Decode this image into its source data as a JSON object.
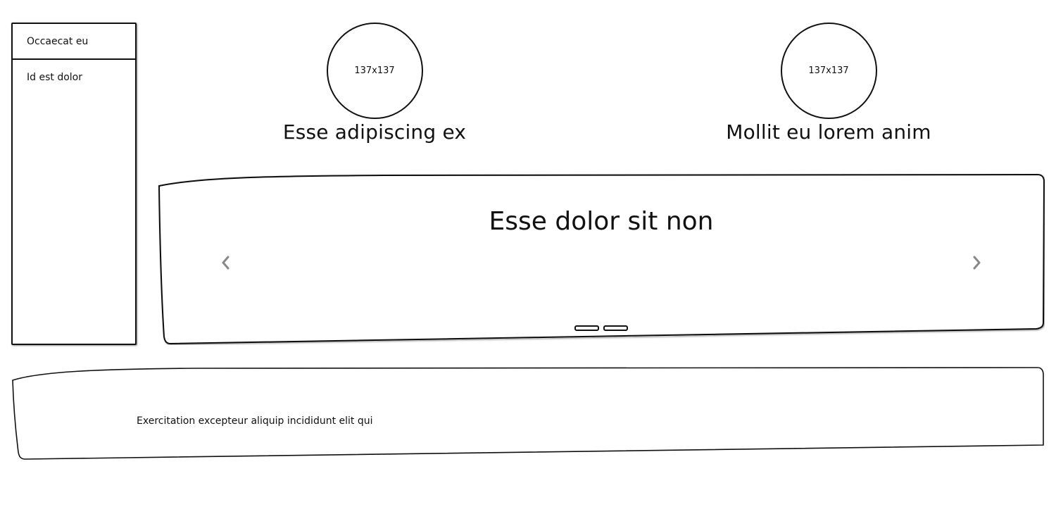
{
  "sidebar": {
    "items": [
      {
        "label": "Occaecat eu"
      },
      {
        "label": "Id est dolor"
      }
    ]
  },
  "cards": [
    {
      "image_label": "137x137",
      "title": "Esse adipiscing ex"
    },
    {
      "image_label": "137x137",
      "title": "Mollit eu lorem anim"
    }
  ],
  "carousel": {
    "title": "Esse dolor sit non",
    "prev_icon": "chevron-left-icon",
    "next_icon": "chevron-right-icon",
    "slide_count": 2
  },
  "footer": {
    "text": "Exercitation excepteur aliquip incididunt elit qui"
  },
  "colors": {
    "stroke": "#111111",
    "arrow": "#888888",
    "background": "#ffffff"
  }
}
